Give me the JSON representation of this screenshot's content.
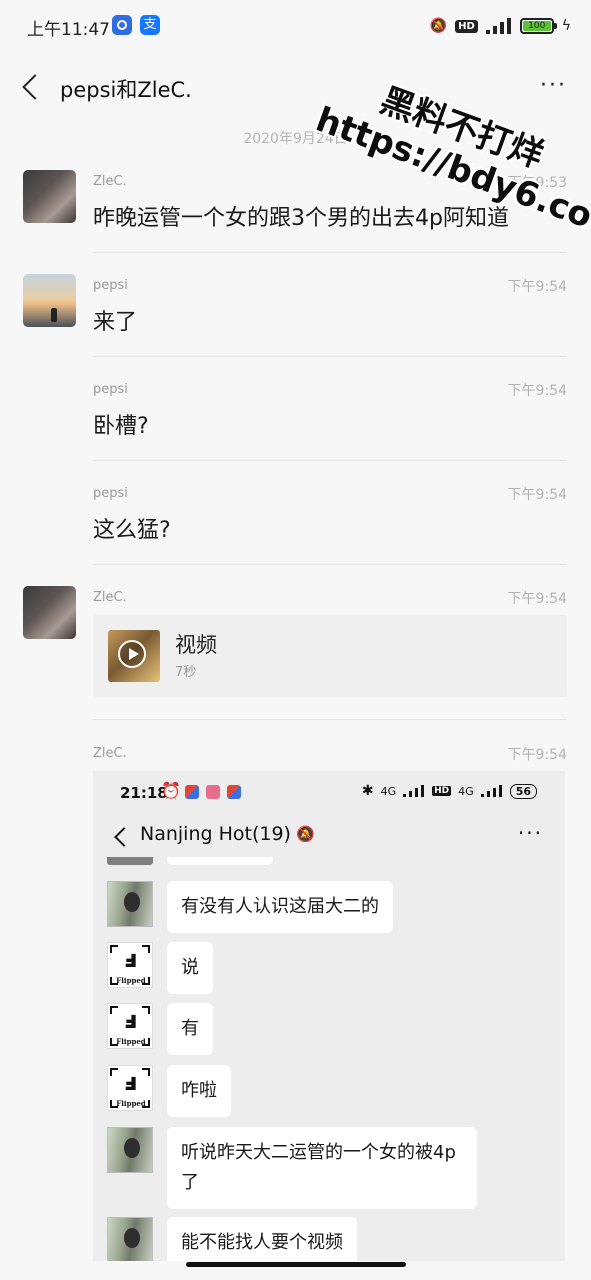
{
  "status_bar": {
    "time": "上午11:47",
    "app2_glyph": "支",
    "hd": "HD",
    "battery": "100",
    "bolt": "ϟ",
    "mute": "🔕"
  },
  "nav": {
    "title": "pepsi和ZleC.",
    "more": "···"
  },
  "date_separator": "2020年9月24日",
  "messages": [
    {
      "name": "ZleC.",
      "time": "下午9:53",
      "text": "昨晚运管一个女的跟3个男的出去4p阿知道"
    },
    {
      "name": "pepsi",
      "time": "下午9:54",
      "text": "来了"
    },
    {
      "name": "pepsi",
      "time": "下午9:54",
      "text": "卧槽?"
    },
    {
      "name": "pepsi",
      "time": "下午9:54",
      "text": "这么猛?"
    },
    {
      "name": "ZleC.",
      "time": "下午9:54",
      "video_title": "视频",
      "video_duration": "7秒"
    },
    {
      "name": "ZleC.",
      "time": "下午9:54"
    }
  ],
  "embedded": {
    "status_time": "21:18",
    "alarm": "⏰",
    "bt": "✱",
    "sig1": "4G",
    "hd": "HD",
    "sig2": "4G",
    "battery": "56",
    "title": "Nanjing Hot(19)",
    "mute": "🔕",
    "more": "···",
    "flipped_glyph": "ⅎ",
    "flipped_label": "Flipped",
    "bubbles": [
      "有没有人认识这届大二的",
      "说",
      "有",
      "咋啦",
      "听说昨天大二运管的一个女的被4p了",
      "能不能找人要个视频"
    ]
  },
  "watermark": {
    "line1": "黑料不打烊",
    "line2": "https://bdy6.co"
  }
}
